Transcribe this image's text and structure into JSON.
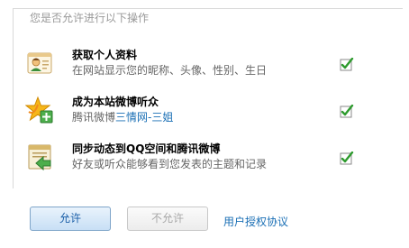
{
  "legend": "您是否允许进行以下操作",
  "permissions": [
    {
      "title": "获取个人资料",
      "description": "在网站显示您的昵称、头像、性别、生日",
      "checked": true,
      "icon": "profile-card-icon"
    },
    {
      "title": "成为本站微博听众",
      "description_prefix": "腾讯微博",
      "description_link": "三情网-三姐",
      "checked": true,
      "icon": "star-plus-icon"
    },
    {
      "title": "同步动态到QQ空间和腾讯微博",
      "description": "好友或听众能够看到您发表的主题和记录",
      "checked": true,
      "icon": "share-arrow-icon"
    }
  ],
  "buttons": {
    "allow": "允许",
    "deny": "不允许"
  },
  "agreement_link": "用户授权协议",
  "colors": {
    "link": "#1a6fb5",
    "check_green": "#2e9b2e",
    "muted": "#999999"
  }
}
